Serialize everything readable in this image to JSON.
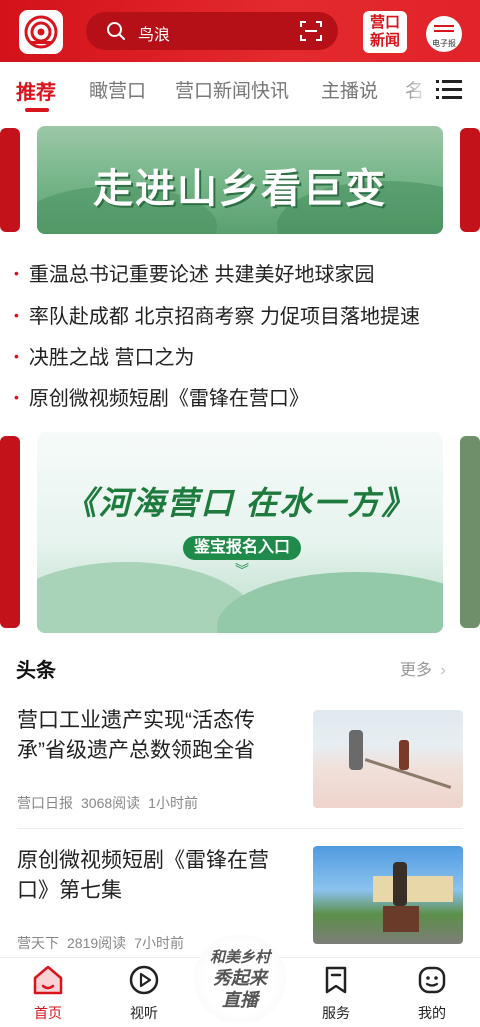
{
  "header": {
    "search_text": "鸟浪",
    "news_button": [
      "营口",
      "新闻"
    ],
    "epaper_label": "电子报",
    "brand_red": "#d8151d"
  },
  "tabs": [
    "推荐",
    "瞰营口",
    "营口新闻快讯",
    "主播说",
    "名"
  ],
  "banner1": {
    "text": "走进山乡看巨变"
  },
  "headlines": [
    "重温总书记重要论述 共建美好地球家园",
    "率队赴成都 北京招商考察 力促项目落地提速",
    "决胜之战 营口之为",
    "原创微视频短剧《雷锋在营口》"
  ],
  "banner2": {
    "title": "《河海营口 在水一方》",
    "button": "鉴宝报名入口"
  },
  "section": {
    "title": "头条",
    "more": "更多"
  },
  "news": [
    {
      "title": "营口工业遗产实现“活态传承”省级遗产总数领跑全省",
      "source": "营口日报",
      "reads": "3068阅读",
      "time": "1小时前"
    },
    {
      "title": "原创微视频短剧《雷锋在营口》第七集",
      "source": "营天下",
      "reads": "2819阅读",
      "time": "7小时前"
    }
  ],
  "bottom_nav": {
    "home": "首页",
    "listen": "视听",
    "center": [
      "和美乡村",
      "秀起来",
      "直播"
    ],
    "service": "服务",
    "mine": "我的"
  }
}
